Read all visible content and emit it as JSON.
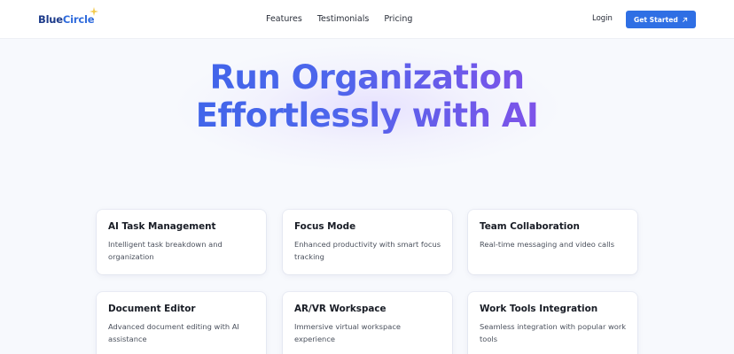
{
  "brand": {
    "name_part1": "Blue",
    "name_part2": "Circle",
    "accent": "#2f6fe4",
    "sparkle_color": "#f2c94c"
  },
  "nav": {
    "links": [
      "Features",
      "Testimonials",
      "Pricing"
    ],
    "login": "Login",
    "cta": "Get Started",
    "cta_icon": "arrow-up-right-icon"
  },
  "hero": {
    "line1": "Run Organization",
    "line2": "Effortlessly with AI",
    "gradient": [
      "#2f63e6",
      "#9b4fe6"
    ]
  },
  "features": [
    {
      "title": "AI Task Management",
      "desc": "Intelligent task breakdown and organization"
    },
    {
      "title": "Focus Mode",
      "desc": "Enhanced productivity with smart focus tracking"
    },
    {
      "title": "Team Collaboration",
      "desc": "Real-time messaging and video calls"
    },
    {
      "title": "Document Editor",
      "desc": "Advanced document editing with AI assistance"
    },
    {
      "title": "AR/VR Workspace",
      "desc": "Immersive virtual workspace experience"
    },
    {
      "title": "Work Tools Integration",
      "desc": "Seamless integration with popular work tools"
    }
  ]
}
